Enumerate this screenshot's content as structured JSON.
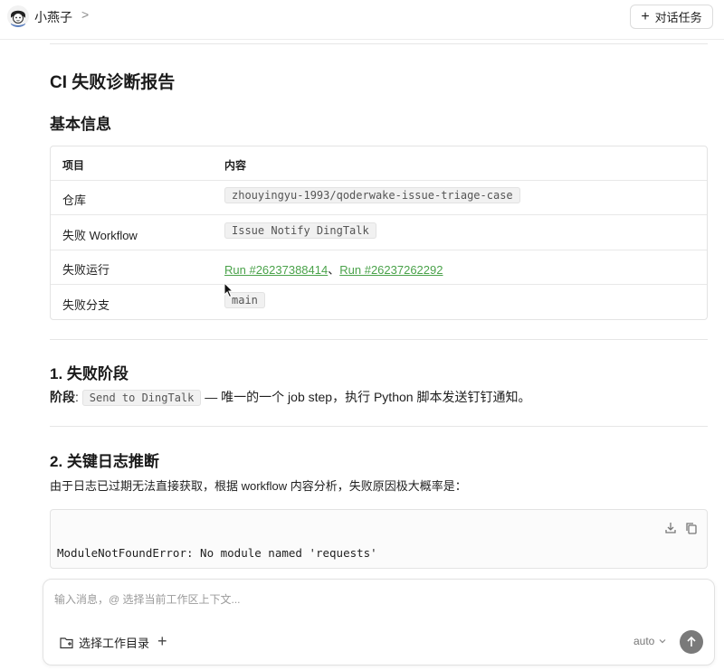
{
  "header": {
    "agent_name": "小燕子",
    "chevron": ">",
    "new_task_label": "对话任务"
  },
  "report": {
    "title": "CI 失败诊断报告",
    "basic_info": {
      "heading": "基本信息",
      "columns": [
        "项目",
        "内容"
      ],
      "rows": [
        {
          "label": "仓库",
          "value": "zhouyingyu-1993/qoderwake-issue-triage-case"
        },
        {
          "label": "失败 Workflow",
          "value": "Issue Notify DingTalk"
        },
        {
          "label": "失败运行",
          "links": [
            "Run #26237388414",
            "Run #26237262292"
          ],
          "separator": "、"
        },
        {
          "label": "失败分支",
          "value": "main"
        }
      ]
    },
    "stage": {
      "heading": "1. 失败阶段",
      "label": "阶段",
      "colon": ":",
      "step": "Send to DingTalk",
      "description": "— 唯一的一个 job step，执行 Python 脚本发送钉钉通知。"
    },
    "log": {
      "heading": "2. 关键日志推断",
      "intro": "由于日志已过期无法直接获取，根据 workflow 内容分析，失败原因极大概率是：",
      "code": "ModuleNotFoundError: No module named 'requests'"
    }
  },
  "composer": {
    "placeholder": "输入消息，@ 选择当前工作区上下文...",
    "dir_label": "选择工作目录",
    "mode": "auto"
  },
  "colors": {
    "link": "#4aa24a",
    "send_button": "#7a7a7a"
  }
}
